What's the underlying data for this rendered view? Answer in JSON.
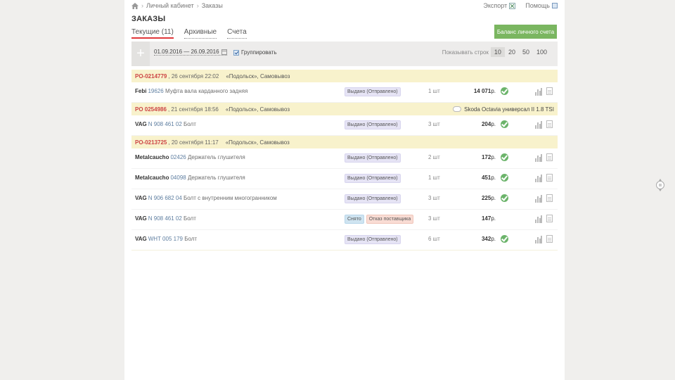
{
  "breadcrumbs": [
    "Личный кабинет",
    "Заказы"
  ],
  "top_links": {
    "export": "Экспорт",
    "help": "Помощь"
  },
  "title": "ЗАКАЗЫ",
  "tabs": [
    {
      "label": "Текущие (11)",
      "active": true
    },
    {
      "label": "Архивные",
      "active": false
    },
    {
      "label": "Счета",
      "active": false
    }
  ],
  "balance_button": "Баланс личного счета",
  "filter": {
    "plus": "+",
    "date_range": "01.09.2016 — 26.09.2016",
    "group_label": "Группировать",
    "group_checked": true,
    "rows_label": "Показывать строк",
    "rows_options": [
      "10",
      "20",
      "50",
      "100"
    ],
    "rows_selected": "10"
  },
  "orders": [
    {
      "number": "PO-0214779",
      "date": ", 26 сентября 22:02",
      "store": "«Подольск», Самовывоз",
      "car": "",
      "items": [
        {
          "brand": "Febi",
          "code": "19626",
          "name": "Муфта вала карданного задняя",
          "badges": [
            {
              "text": "Выдано (Отправлено)",
              "kind": "violet"
            }
          ],
          "qty": "1 шт",
          "price": "14 071",
          "currency": "р.",
          "ok": true
        }
      ]
    },
    {
      "number": "PO 0254986",
      "date": ", 21 сентября 18:56",
      "store": "«Подольск», Самовывоз",
      "car": "Skoda Octavia универсал II 1.8 TSI",
      "items": [
        {
          "brand": "VAG",
          "code": "N 908 461 02",
          "name": "Болт",
          "badges": [
            {
              "text": "Выдано (Отправлено)",
              "kind": "violet"
            }
          ],
          "qty": "3 шт",
          "price": "204",
          "currency": "р.",
          "ok": true
        }
      ]
    },
    {
      "number": "PO-0213725",
      "date": ", 20 сентября 11:17",
      "store": "«Подольск», Самовывоз",
      "car": "",
      "items": [
        {
          "brand": "Metalcaucho",
          "code": "02426",
          "name": "Держатель глушителя",
          "badges": [
            {
              "text": "Выдано (Отправлено)",
              "kind": "violet"
            }
          ],
          "qty": "2 шт",
          "price": "172",
          "currency": "р.",
          "ok": true
        },
        {
          "brand": "Metalcaucho",
          "code": "04098",
          "name": "Держатель глушителя",
          "badges": [
            {
              "text": "Выдано (Отправлено)",
              "kind": "violet"
            }
          ],
          "qty": "1 шт",
          "price": "451",
          "currency": "р.",
          "ok": true
        },
        {
          "brand": "VAG",
          "code": "N 906 682 04",
          "name": "Болт с внутренним многогранником",
          "badges": [
            {
              "text": "Выдано (Отправлено)",
              "kind": "violet"
            }
          ],
          "qty": "3 шт",
          "price": "225",
          "currency": "р.",
          "ok": true
        },
        {
          "brand": "VAG",
          "code": "N 908 461 02",
          "name": "Болт",
          "badges": [
            {
              "text": "Снято",
              "kind": "blue"
            },
            {
              "text": "Отказ поставщика",
              "kind": "red"
            }
          ],
          "qty": "3 шт",
          "price": "147",
          "currency": "р.",
          "ok": false
        },
        {
          "brand": "VAG",
          "code": "WHT 005 179",
          "name": "Болт",
          "badges": [
            {
              "text": "Выдано (Отправлено)",
              "kind": "violet"
            }
          ],
          "qty": "6 шт",
          "price": "342",
          "currency": "р.",
          "ok": true
        }
      ]
    }
  ],
  "colors": {
    "accent_red": "#e0383a",
    "button_green": "#7ab660",
    "order_header": "#f8f2cc",
    "ok_green": "#6cb46b"
  }
}
